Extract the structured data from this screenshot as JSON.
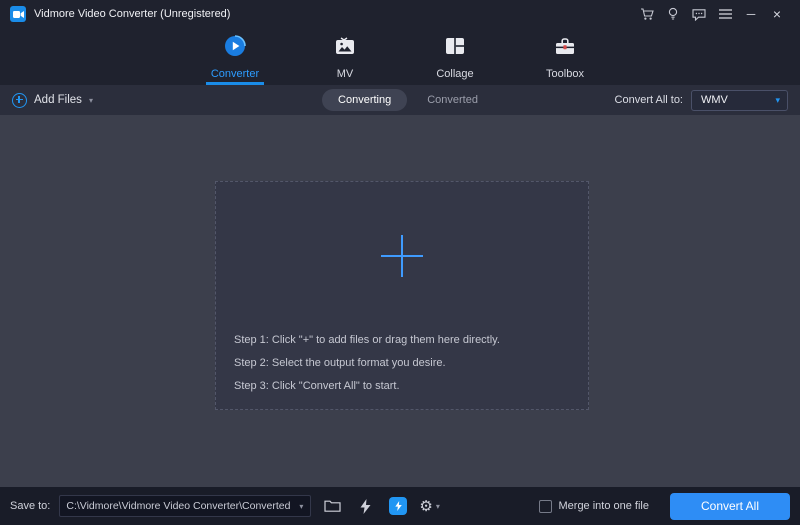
{
  "titlebar": {
    "title": "Vidmore Video Converter (Unregistered)",
    "icon_names": [
      "cart",
      "lightbulb",
      "feedback",
      "menu",
      "minimize",
      "close"
    ]
  },
  "icons": {
    "caret_down": "▾",
    "gear": "⚙",
    "minimize": "─",
    "close": "×"
  },
  "nav": {
    "tabs": [
      {
        "label": "Converter",
        "active": true
      },
      {
        "label": "MV",
        "active": false
      },
      {
        "label": "Collage",
        "active": false
      },
      {
        "label": "Toolbox",
        "active": false
      }
    ]
  },
  "toolbar": {
    "add_files": "Add Files",
    "converting": "Converting",
    "converted": "Converted",
    "convert_all_to": "Convert All to:",
    "format": "WMV"
  },
  "dropzone": {
    "steps": [
      "Step 1: Click \"+\" to add files or drag them here directly.",
      "Step 2: Select the output format you desire.",
      "Step 3: Click \"Convert All\" to start."
    ]
  },
  "bottombar": {
    "save_to": "Save to:",
    "path": "C:\\Vidmore\\Vidmore Video Converter\\Converted",
    "merge": "Merge into one file",
    "convert_all": "Convert All"
  },
  "colors": {
    "accent": "#2196f3",
    "active_tab": "#2d9cff",
    "convert_button": "#2e8df5",
    "titlebar_bg": "#1f222e",
    "toolbar_bg": "#2b2e3c",
    "main_bg": "#3c3f4c",
    "bottombar_bg": "#191c28"
  }
}
